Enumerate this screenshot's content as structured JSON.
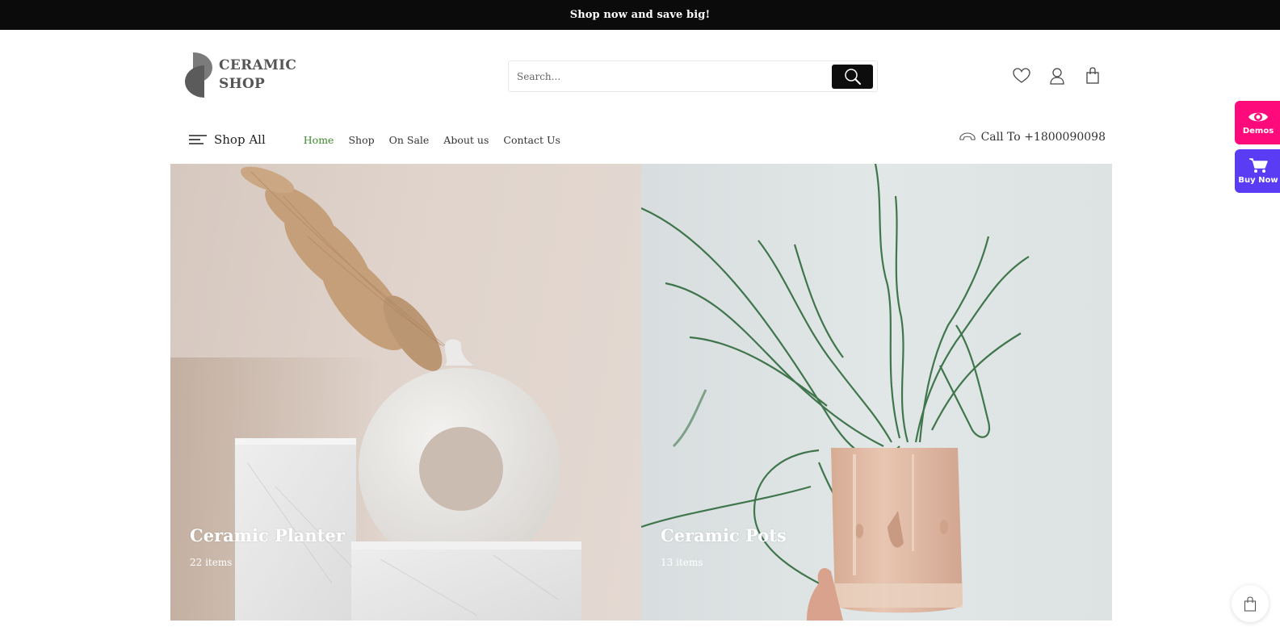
{
  "announcement": "Shop now and save big!",
  "logo": {
    "line1": "CERAMIC",
    "line2": "SHOP"
  },
  "search": {
    "placeholder": "Search...",
    "value": ""
  },
  "header_icons": [
    "heart-icon",
    "user-icon",
    "shopping-bag-icon"
  ],
  "nav": {
    "shop_all": "Shop All",
    "items": [
      {
        "label": "Home",
        "active": true
      },
      {
        "label": "Shop",
        "active": false
      },
      {
        "label": "On Sale",
        "active": false
      },
      {
        "label": "About us",
        "active": false
      },
      {
        "label": "Contact Us",
        "active": false
      }
    ],
    "call": "Call To +1800090098"
  },
  "categories": [
    {
      "title": "Ceramic Planter",
      "count": "22 items"
    },
    {
      "title": "Ceramic Pots",
      "count": "13 items"
    }
  ],
  "side_buttons": {
    "demos": "Demos",
    "buy_now": "Buy Now"
  },
  "colors": {
    "topbar": "#0b0b0b",
    "active_nav": "#3a8a2a",
    "demos": "#ff0a7a",
    "buy_now": "#5b3cf5"
  }
}
